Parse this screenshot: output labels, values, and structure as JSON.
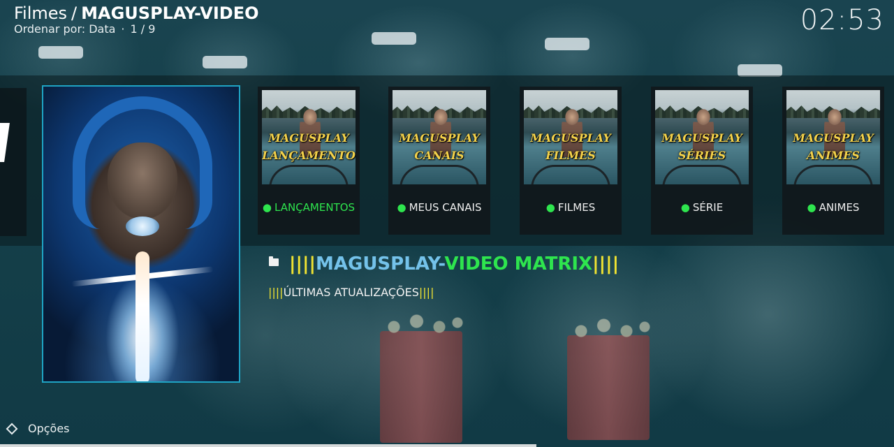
{
  "header": {
    "breadcrumb_root": "Filmes",
    "breadcrumb_separator": "/",
    "breadcrumb_current": "MAGUSPLAY-VIDEO",
    "sort_label": "Ordenar por: Data",
    "sort_separator": "·",
    "page_counter": "1 / 9",
    "clock": "02:53"
  },
  "tiles": [
    {
      "thumb_line1": "MAGUSPLAY",
      "thumb_line2": "LANÇAMENTO",
      "caption": "LANÇAMENTOS",
      "active": true
    },
    {
      "thumb_line1": "MAGUSPLAY",
      "thumb_line2": "CANAIS",
      "caption": "MEUS CANAIS",
      "active": false
    },
    {
      "thumb_line1": "MAGUSPLAY",
      "thumb_line2": "FILMES",
      "caption": "FILMES",
      "active": false
    },
    {
      "thumb_line1": "MAGUSPLAY",
      "thumb_line2": "SÉRIES",
      "caption": "SÉRIE",
      "active": false
    },
    {
      "thumb_line1": "MAGUSPLAY",
      "thumb_line2": "ANIMES",
      "caption": "ANIMES",
      "active": false
    }
  ],
  "info": {
    "title_prefix": "||||",
    "title_part1": "MAGUSPLAY-",
    "title_part2": "VIDEO MATRIX",
    "title_suffix": "||||",
    "sub_prefix": "||||",
    "sub_text": "ÚLTIMAS ATUALIZAÇÕES",
    "sub_suffix": "||||"
  },
  "footer": {
    "options_label": "Opções"
  },
  "icons": {
    "folder": "folder-icon",
    "options": "options-icon"
  },
  "colors": {
    "accent_green": "#2ee54e",
    "accent_yellow": "#f0e332",
    "accent_blue": "#74c2ea",
    "focus_border": "#1fa4c4"
  }
}
